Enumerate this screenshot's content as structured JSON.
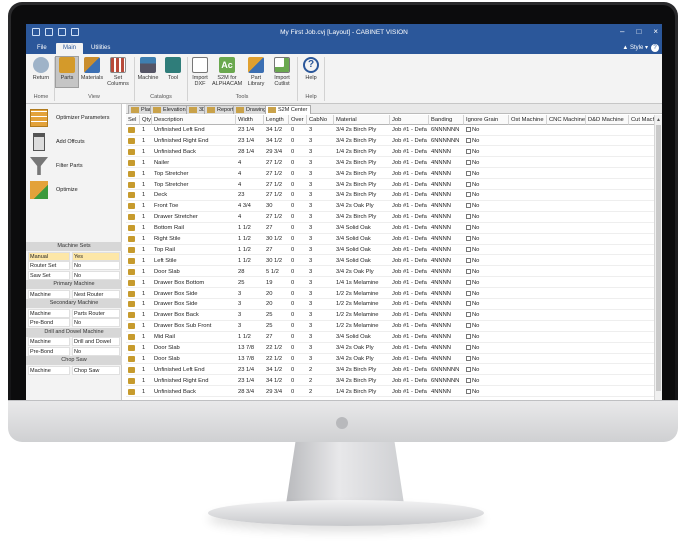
{
  "window": {
    "title": "My First Job.cvj [Layout] - CABINET VISION"
  },
  "tabs": [
    "File",
    "Main",
    "Utilities"
  ],
  "active_tab": "Main",
  "style_menu": "Style",
  "help_symbol": "?",
  "ribbon": {
    "buttons": {
      "return": "Return",
      "parts": "Parts",
      "materials": "Materials",
      "set_columns": "Set Columns",
      "machine": "Machine",
      "tool": "Tool",
      "import_dxf": "Import DXF",
      "s2m_alphacam": "S2M for ALPHACAM",
      "part_library": "Part Library",
      "import_cutlist": "Import Cutlist",
      "help": "Help"
    },
    "groups": {
      "home": "Home",
      "view": "View",
      "catalogs": "Catalogs",
      "tools": "Tools",
      "help": "Help"
    }
  },
  "doc_tabs": [
    "Plan",
    "Elevation",
    "3D",
    "Reports",
    "Drawings",
    "S2M Center"
  ],
  "left_panel": {
    "buttons": [
      "Optimizer Parameters",
      "Add Offcuts",
      "Filter Parts",
      "Optimize"
    ],
    "sections": [
      {
        "header": "Machine Sets",
        "rows": [
          [
            "Manual",
            "Yes"
          ],
          [
            "Router Set",
            "No"
          ],
          [
            "Saw Set",
            "No"
          ]
        ]
      },
      {
        "header": "Primary Machine",
        "rows": [
          [
            "Machine",
            "Nest Router"
          ]
        ]
      },
      {
        "header": "Secondary Machine",
        "rows": [
          [
            "Machine",
            "Parts Router"
          ],
          [
            "Pre-Bond",
            "No"
          ]
        ]
      },
      {
        "header": "Drill and Dowel Machine",
        "rows": [
          [
            "Machine",
            "Drill and Dowel"
          ],
          [
            "Pre-Bond",
            "No"
          ]
        ]
      },
      {
        "header": "Chop Saw",
        "rows": [
          [
            "Machine",
            "Chop Saw"
          ]
        ]
      }
    ]
  },
  "grid": {
    "columns": [
      "Sel",
      "Qty",
      "Description",
      "Width",
      "Length",
      "Over",
      "CabNo",
      "Material",
      "Job",
      "Banding",
      "Ignore Grain",
      "Ost Machine",
      "CNC Machine",
      "D&D Machine",
      "Cut Mach"
    ],
    "rows": [
      [
        "1",
        "Unfinished Left End",
        "23 1/4",
        "34 1/2",
        "0",
        "3",
        "3/4 2s Birch Ply",
        "Job #1 - Defa",
        "6NNNNNN",
        "No"
      ],
      [
        "1",
        "Unfinished Right End",
        "23 1/4",
        "34 1/2",
        "0",
        "3",
        "3/4 2s Birch Ply",
        "Job #1 - Defa",
        "6NNNNNN",
        "No"
      ],
      [
        "1",
        "Unfinished Back",
        "28 1/4",
        "29 3/4",
        "0",
        "3",
        "1/4 2s Birch Ply",
        "Job #1 - Defa",
        "4NNNN",
        "No"
      ],
      [
        "1",
        "Nailer",
        "4",
        "27 1/2",
        "0",
        "3",
        "3/4 2s Birch Ply",
        "Job #1 - Defa",
        "4NNNN",
        "No"
      ],
      [
        "1",
        "Top Stretcher",
        "4",
        "27 1/2",
        "0",
        "3",
        "3/4 2s Birch Ply",
        "Job #1 - Defa",
        "4NNNN",
        "No"
      ],
      [
        "1",
        "Top Stretcher",
        "4",
        "27 1/2",
        "0",
        "3",
        "3/4 2s Birch Ply",
        "Job #1 - Defa",
        "4NNNN",
        "No"
      ],
      [
        "1",
        "Deck",
        "23",
        "27 1/2",
        "0",
        "3",
        "3/4 2s Birch Ply",
        "Job #1 - Defa",
        "4NNNN",
        "No"
      ],
      [
        "1",
        "Front Toe",
        "4 3/4",
        "30",
        "0",
        "3",
        "3/4 2s Oak Ply",
        "Job #1 - Defa",
        "4NNNN",
        "No"
      ],
      [
        "1",
        "Drawer Stretcher",
        "4",
        "27 1/2",
        "0",
        "3",
        "3/4 2s Birch Ply",
        "Job #1 - Defa",
        "4NNNN",
        "No"
      ],
      [
        "1",
        "Bottom Rail",
        "1 1/2",
        "27",
        "0",
        "3",
        "3/4 Solid Oak",
        "Job #1 - Defa",
        "4NNNN",
        "No"
      ],
      [
        "1",
        "Right Stile",
        "1 1/2",
        "30 1/2",
        "0",
        "3",
        "3/4 Solid Oak",
        "Job #1 - Defa",
        "4NNNN",
        "No"
      ],
      [
        "1",
        "Top Rail",
        "1 1/2",
        "27",
        "0",
        "3",
        "3/4 Solid Oak",
        "Job #1 - Defa",
        "4NNNN",
        "No"
      ],
      [
        "1",
        "Left Stile",
        "1 1/2",
        "30 1/2",
        "0",
        "3",
        "3/4 Solid Oak",
        "Job #1 - Defa",
        "4NNNN",
        "No"
      ],
      [
        "1",
        "Door Slab",
        "28",
        "5 1/2",
        "0",
        "3",
        "3/4 2s Oak Ply",
        "Job #1 - Defa",
        "4NNNN",
        "No"
      ],
      [
        "1",
        "Drawer Box Bottom",
        "25",
        "19",
        "0",
        "3",
        "1/4 1s Melamine",
        "Job #1 - Defa",
        "4NNNN",
        "No"
      ],
      [
        "1",
        "Drawer Box Side",
        "3",
        "20",
        "0",
        "3",
        "1/2 2s Melamine",
        "Job #1 - Defa",
        "4NNNN",
        "No"
      ],
      [
        "1",
        "Drawer Box Side",
        "3",
        "20",
        "0",
        "3",
        "1/2 2s Melamine",
        "Job #1 - Defa",
        "4NNNN",
        "No"
      ],
      [
        "1",
        "Drawer Box Back",
        "3",
        "25",
        "0",
        "3",
        "1/2 2s Melamine",
        "Job #1 - Defa",
        "4NNNN",
        "No"
      ],
      [
        "1",
        "Drawer Box Sub Front",
        "3",
        "25",
        "0",
        "3",
        "1/2 2s Melamine",
        "Job #1 - Defa",
        "4NNNN",
        "No"
      ],
      [
        "1",
        "Mid Rail",
        "1 1/2",
        "27",
        "0",
        "3",
        "3/4 Solid Oak",
        "Job #1 - Defa",
        "4NNNN",
        "No"
      ],
      [
        "1",
        "Door Slab",
        "13 7/8",
        "22 1/2",
        "0",
        "3",
        "3/4 2s Oak Ply",
        "Job #1 - Defa",
        "4NNNN",
        "No"
      ],
      [
        "1",
        "Door Slab",
        "13 7/8",
        "22 1/2",
        "0",
        "3",
        "3/4 2s Oak Ply",
        "Job #1 - Defa",
        "4NNNN",
        "No"
      ],
      [
        "1",
        "Unfinished Left End",
        "23 1/4",
        "34 1/2",
        "0",
        "2",
        "3/4 2s Birch Ply",
        "Job #1 - Defa",
        "6NNNNNN",
        "No"
      ],
      [
        "1",
        "Unfinished Right End",
        "23 1/4",
        "34 1/2",
        "0",
        "2",
        "3/4 2s Birch Ply",
        "Job #1 - Defa",
        "6NNNNNN",
        "No"
      ],
      [
        "1",
        "Unfinished Back",
        "28 3/4",
        "29 3/4",
        "0",
        "2",
        "1/4 2s Birch Ply",
        "Job #1 - Defa",
        "4NNNN",
        "No"
      ]
    ]
  },
  "colors": {
    "title_bar": "#2b579a",
    "selected_row": "#fde7a7",
    "part_icon": "#c79b2d"
  }
}
